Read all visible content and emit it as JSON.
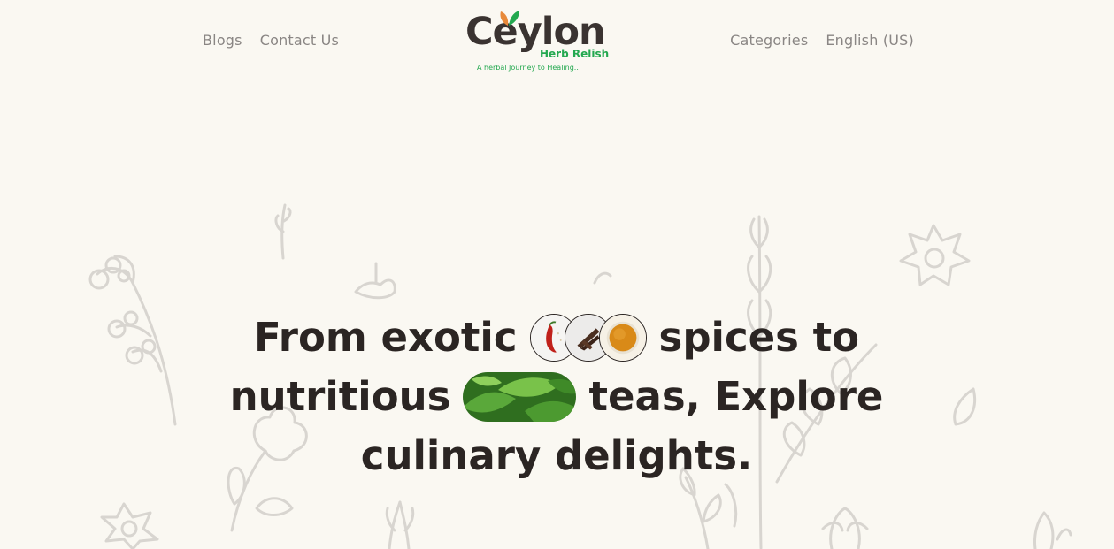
{
  "nav": {
    "left": [
      "Blogs",
      "Contact Us"
    ],
    "right": [
      "Categories",
      "English (US)"
    ]
  },
  "logo": {
    "wordmark": "Ceylon",
    "subtitle": "Herb Relish",
    "tagline": "A herbal Journey to Healing.."
  },
  "hero": {
    "part1": "From exotic",
    "part2": "spices to",
    "part3": "nutritious",
    "part4": "teas, Explore",
    "part5": "culinary delights."
  },
  "images": {
    "spices": [
      "chili-pepper",
      "cinnamon-sticks",
      "turmeric-powder"
    ],
    "tea": "tea-leaves"
  },
  "colors": {
    "background": "#faf8f2",
    "text": "#2b2523",
    "nav": "#8a8684",
    "brand_green": "#23a84f",
    "brand_dark": "#3a3331",
    "doodle": "#d8d5d0"
  }
}
